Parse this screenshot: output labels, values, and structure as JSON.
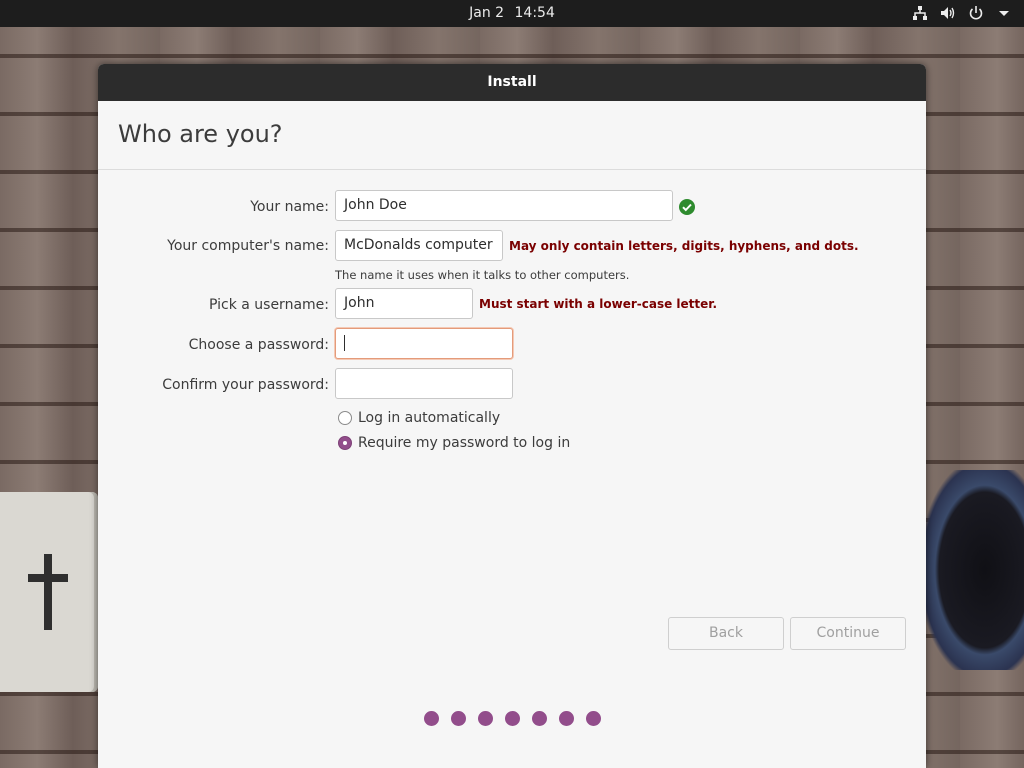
{
  "topbar": {
    "date": "Jan 2",
    "time": "14:54",
    "icons": [
      "network-icon",
      "volume-icon",
      "power-icon",
      "system-menu-chevron-icon"
    ]
  },
  "window": {
    "title": "Install",
    "heading": "Who are you?"
  },
  "form": {
    "name": {
      "label": "Your name:",
      "value": "John Doe",
      "status_icon": "check-circle-icon",
      "status_color": "#2e8b2e"
    },
    "computer_name": {
      "label": "Your computer's name:",
      "value": "McDonalds computer",
      "error": "May only contain letters, digits, hyphens, and dots.",
      "hint": "The name it uses when it talks to other computers."
    },
    "username": {
      "label": "Pick a username:",
      "value": "John",
      "error": "Must start with a lower-case letter."
    },
    "password": {
      "label": "Choose a password:",
      "value": ""
    },
    "confirm_password": {
      "label": "Confirm your password:",
      "value": ""
    },
    "login_options": [
      {
        "label": "Log in automatically",
        "selected": false
      },
      {
        "label": "Require my password to log in",
        "selected": true
      }
    ]
  },
  "buttons": {
    "back": "Back",
    "continue": "Continue"
  },
  "progress": {
    "steps": 7
  },
  "colors": {
    "accent": "#924d8b",
    "error": "#7a0000",
    "focus_border": "#e49b7a"
  }
}
